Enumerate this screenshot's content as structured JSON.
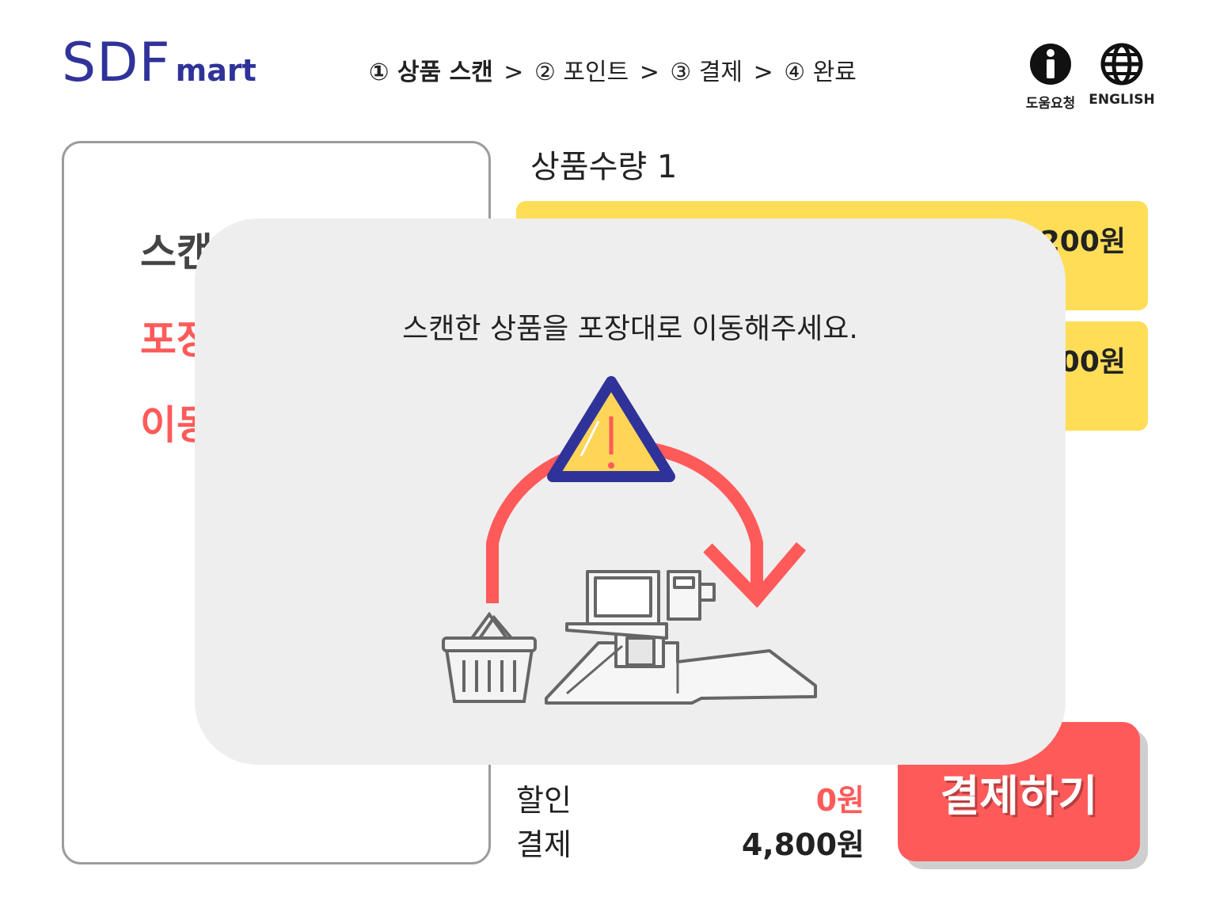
{
  "header": {
    "logo_main": "SDF",
    "logo_sub": "mart",
    "steps": [
      {
        "label": "① 상품 스캔"
      },
      {
        "label": "② 포인트"
      },
      {
        "label": "③ 결제"
      },
      {
        "label": "④ 완료"
      }
    ],
    "step_separator": ">",
    "help_label": "도움요청",
    "language_label": "ENGLISH"
  },
  "left_panel": {
    "lines": [
      "스캔한",
      "포장",
      "이동"
    ]
  },
  "cart": {
    "quantity_label": "상품수량 1",
    "items": [
      {
        "price": "1,200원"
      },
      {
        "price": "00원"
      }
    ]
  },
  "summary": {
    "discount_label": "할인",
    "discount_value": "0원",
    "total_label": "결제",
    "total_value": "4,800원"
  },
  "pay_button": "결제하기",
  "modal": {
    "message": "스캔한 상품을 포장대로 이동해주세요.",
    "icons": [
      "warning-icon",
      "basket-icon",
      "checkout-machine-icon"
    ]
  },
  "colors": {
    "brand": "#2f3399",
    "accent_red": "#ff5a5a",
    "item_yellow": "#ffdd57",
    "modal_bg": "#eeeeee"
  }
}
